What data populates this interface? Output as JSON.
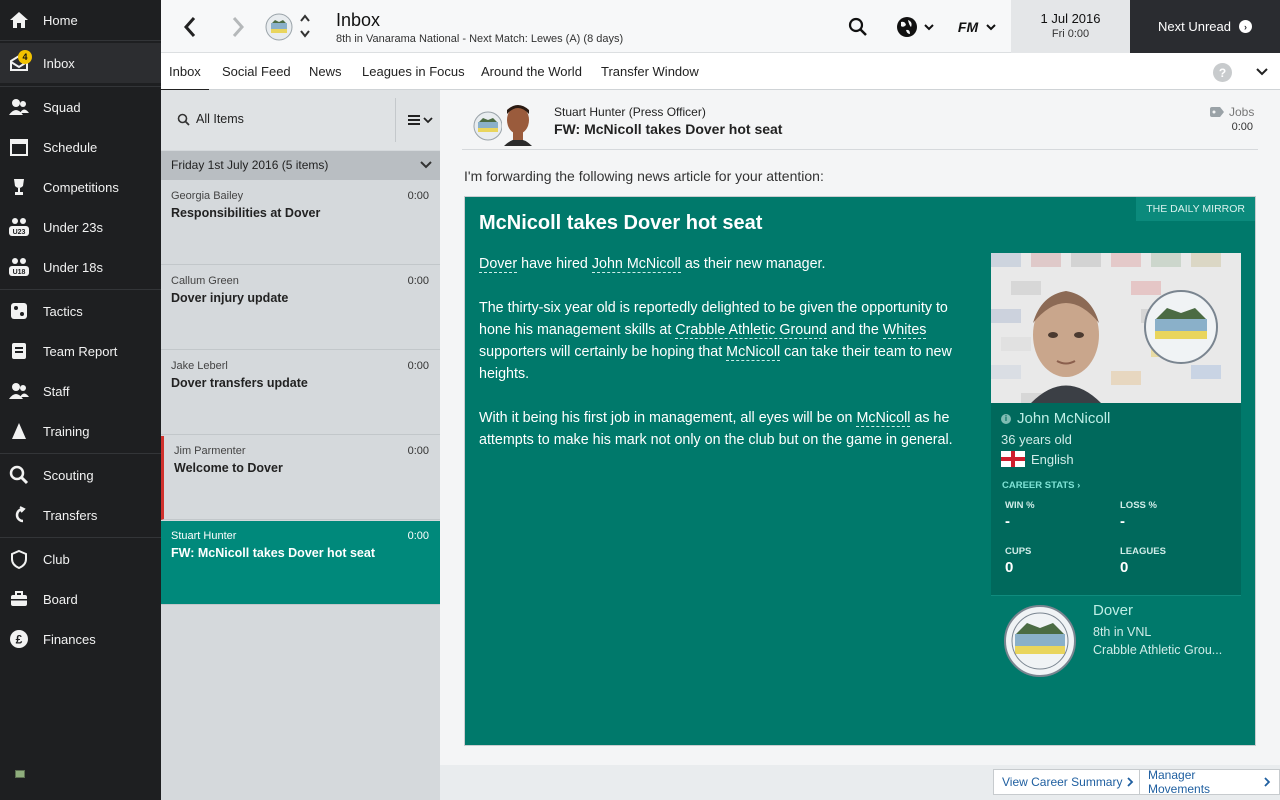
{
  "sidebar": {
    "items": [
      {
        "label": "Home",
        "icon": "home-icon"
      },
      {
        "label": "Inbox",
        "icon": "inbox-icon",
        "badge": "4"
      },
      {
        "label": "Squad",
        "icon": "squad-icon"
      },
      {
        "label": "Schedule",
        "icon": "calendar-icon"
      },
      {
        "label": "Competitions",
        "icon": "trophy-icon"
      },
      {
        "label": "Under 23s",
        "icon": "u23-icon",
        "icon_text": "U23"
      },
      {
        "label": "Under 18s",
        "icon": "u18-icon",
        "icon_text": "U18"
      },
      {
        "label": "Tactics",
        "icon": "tactics-icon"
      },
      {
        "label": "Team Report",
        "icon": "report-icon"
      },
      {
        "label": "Staff",
        "icon": "staff-icon"
      },
      {
        "label": "Training",
        "icon": "training-icon"
      },
      {
        "label": "Scouting",
        "icon": "scouting-icon"
      },
      {
        "label": "Transfers",
        "icon": "transfers-icon"
      },
      {
        "label": "Club",
        "icon": "club-icon"
      },
      {
        "label": "Board",
        "icon": "board-icon"
      },
      {
        "label": "Finances",
        "icon": "finances-icon"
      }
    ]
  },
  "header": {
    "title": "Inbox",
    "subtitle": "8th in Vanarama National - Next Match: Lewes (A) (8 days)",
    "fm_label": "FM",
    "date": "1 Jul 2016",
    "day_time": "Fri 0:00",
    "next_unread": "Next Unread"
  },
  "tabs": [
    "Inbox",
    "Social Feed",
    "News",
    "Leagues in Focus",
    "Around the World",
    "Transfer Window"
  ],
  "help_label": "?",
  "list": {
    "search_label": "All Items",
    "group_title": "Friday 1st July 2016 (5 items)",
    "messages": [
      {
        "sender": "Georgia Bailey",
        "time": "0:00",
        "subject": "Responsibilities at Dover"
      },
      {
        "sender": "Callum Green",
        "time": "0:00",
        "subject": "Dover injury update"
      },
      {
        "sender": "Jake Leberl",
        "time": "0:00",
        "subject": "Dover transfers update"
      },
      {
        "sender": "Jim Parmenter",
        "time": "0:00",
        "subject": "Welcome to Dover"
      },
      {
        "sender": "Stuart Hunter",
        "time": "0:00",
        "subject": "FW: McNicoll takes Dover hot seat"
      }
    ]
  },
  "message": {
    "from": "Stuart Hunter  (Press Officer)",
    "title": "FW: McNicoll takes Dover hot seat",
    "tag": "Jobs",
    "tag_time": "0:00",
    "intro": "I'm forwarding the following news article for your attention:",
    "article": {
      "source": "THE DAILY MIRROR",
      "headline": "McNicoll takes Dover hot seat",
      "p1": {
        "a": "Dover",
        "b": " have hired ",
        "c": "John McNicoll",
        "d": " as their new manager."
      },
      "p2": {
        "a": "The thirty-six year old is reportedly delighted to be given the opportunity to hone his management skills at ",
        "b": "Crabble Athletic Ground",
        "c": " and the ",
        "d": "Whites",
        "e": " supporters will certainly be hoping that ",
        "f": "McNicoll",
        "g": " can take their team to new heights."
      },
      "p3": {
        "a": "With it being his first job in management, all eyes will be on ",
        "b": "McNicoll",
        "c": " as he attempts to make his mark not only on the club but on the game in general."
      }
    },
    "profile": {
      "name": "John McNicoll",
      "age": "36 years old",
      "nationality": "English",
      "career_stats_label": "CAREER STATS ›",
      "win_label": "WIN %",
      "win_value": "-",
      "loss_label": "LOSS %",
      "loss_value": "-",
      "cups_label": "CUPS",
      "cups_value": "0",
      "leagues_label": "LEAGUES",
      "leagues_value": "0"
    },
    "club": {
      "name": "Dover",
      "position": "8th in VNL",
      "ground": "Crabble Athletic Grou..."
    }
  },
  "footer": {
    "career_summary": "View Career Summary",
    "manager_movements": "Manager Movements"
  },
  "colors": {
    "sidebar_bg": "#1e1f21",
    "accent_teal": "#00897b",
    "article_bg": "#00796b",
    "badge_yellow": "#f2c200"
  }
}
